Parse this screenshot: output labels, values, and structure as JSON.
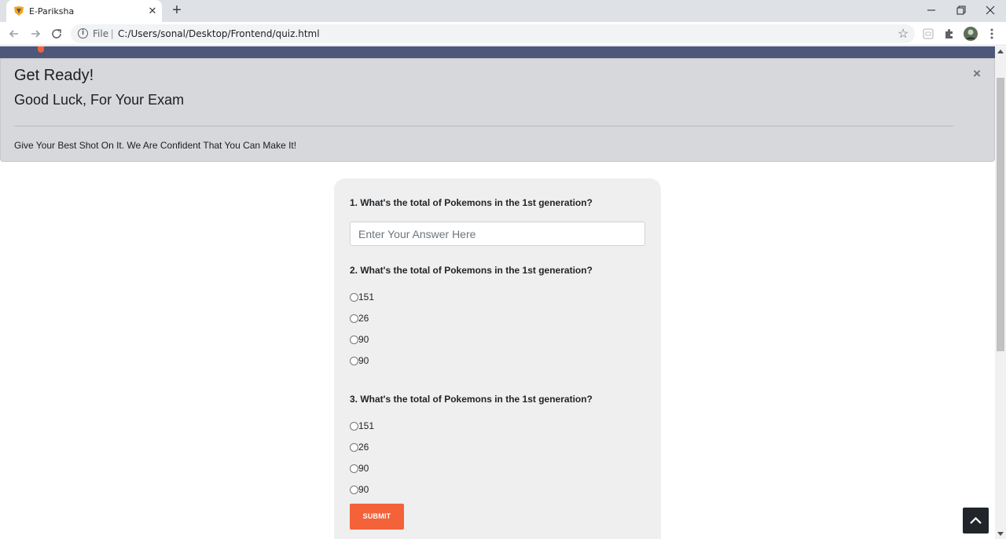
{
  "browser": {
    "tab_title": "E-Pariksha",
    "tab_close": "✕",
    "new_tab": "+",
    "url_scheme": "File",
    "url_separator": "|",
    "url_path": "C:/Users/sonal/Desktop/Frontend/quiz.html"
  },
  "alert": {
    "title": "Get Ready!",
    "subtitle": "Good Luck, For Your Exam",
    "message": "Give Your Best Shot On It. We Are Confident That You Can Make It!",
    "close": "×"
  },
  "quiz": {
    "q1": {
      "text": "1. What's the total of Pokemons in the 1st generation?",
      "placeholder": "Enter Your Answer Here"
    },
    "q2": {
      "text": "2. What's the total of Pokemons in the 1st generation?",
      "options": [
        "151",
        "26",
        "90",
        "90"
      ]
    },
    "q3": {
      "text": "3. What's the total of Pokemons in the 1st generation?",
      "options": [
        "151",
        "26",
        "90",
        "90"
      ]
    },
    "submit_label": "SUBMIT"
  },
  "colors": {
    "accent": "#f4623a",
    "navbar": "#4c577a",
    "alert_bg": "#d6d8db",
    "card_bg": "#efefef"
  },
  "icons": [
    "favicon-icon",
    "close-icon",
    "back-arrow-icon",
    "forward-arrow-icon",
    "reload-icon",
    "info-icon",
    "star-icon",
    "extension-icon",
    "puzzle-icon",
    "avatar",
    "menu-icon",
    "chevron-up-icon"
  ]
}
